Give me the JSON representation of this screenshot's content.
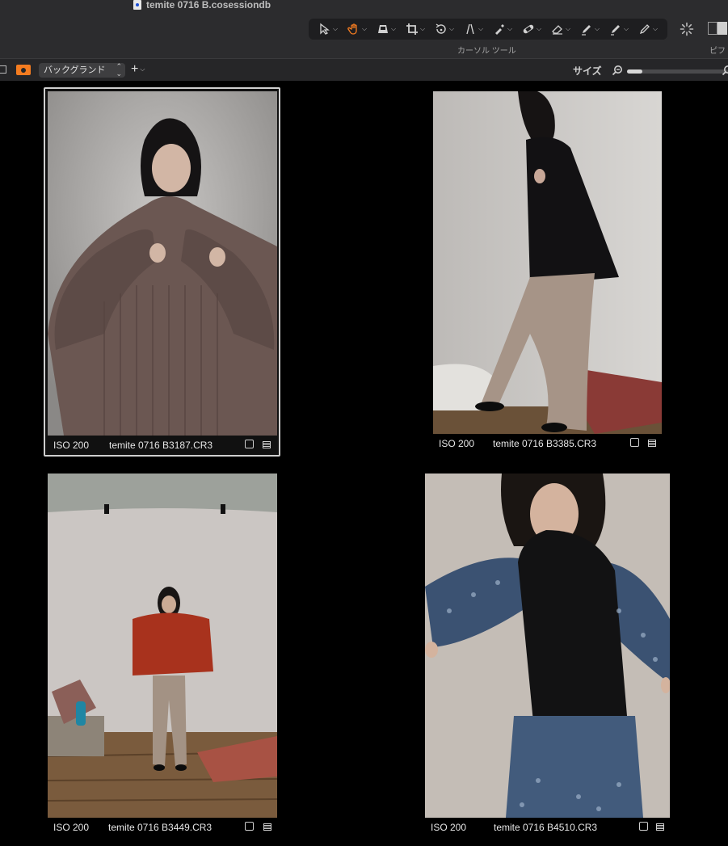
{
  "window": {
    "title": "temite 0716 B.cosessiondb"
  },
  "toolbar": {
    "cursor_tools_label": "カーソル ツール",
    "right_label": "ピフ",
    "tools": [
      {
        "name": "select-tool",
        "icon": "arrow-pointer-icon"
      },
      {
        "name": "pan-tool",
        "icon": "hand-icon",
        "active": true
      },
      {
        "name": "keystone-tool",
        "icon": "keystone-icon"
      },
      {
        "name": "crop-tool",
        "icon": "crop-icon"
      },
      {
        "name": "rotate-tool",
        "icon": "rotate-icon"
      },
      {
        "name": "straighten-tool",
        "icon": "straighten-icon"
      },
      {
        "name": "picker-tool",
        "icon": "picker-icon"
      },
      {
        "name": "spot-tool",
        "icon": "bandage-icon"
      },
      {
        "name": "erase-tool",
        "icon": "eraser-icon"
      },
      {
        "name": "brush-tool",
        "icon": "brush-icon"
      },
      {
        "name": "gradient-tool",
        "icon": "gradient-icon"
      },
      {
        "name": "annotate-tool",
        "icon": "pencil-icon"
      }
    ],
    "accent_color": "#f47c20"
  },
  "subbar": {
    "background_select": "バックグランド",
    "size_label": "サイズ",
    "size_value": 0.15
  },
  "images": [
    {
      "iso": "ISO 200",
      "filename": "temite 0716 B3187.CR3",
      "selected": true
    },
    {
      "iso": "ISO 200",
      "filename": "temite 0716 B3385.CR3",
      "selected": false
    },
    {
      "iso": "ISO 200",
      "filename": "temite 0716 B3449.CR3",
      "selected": false
    },
    {
      "iso": "ISO 200",
      "filename": "temite 0716 B4510.CR3",
      "selected": false
    }
  ]
}
